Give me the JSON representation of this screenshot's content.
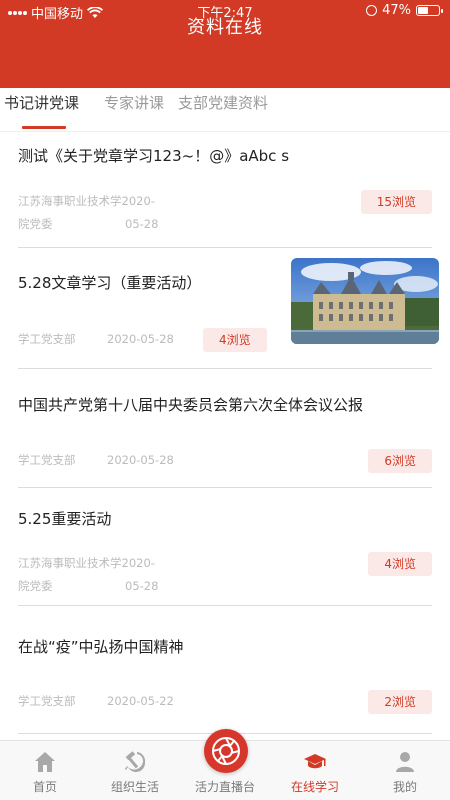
{
  "status_bar": {
    "carrier": "中国移动",
    "time": "下午2:47",
    "battery": "47%"
  },
  "header": {
    "title": "资料在线"
  },
  "tabs": [
    {
      "label": "书记讲党课",
      "active": true
    },
    {
      "label": "专家讲课",
      "active": false
    },
    {
      "label": "支部党建资料",
      "active": false
    }
  ],
  "articles": [
    {
      "title": "测试《关于党章学习123~！@》aAbc s",
      "source_line1": "江苏海事职业技术学2020-",
      "source_line2": "院党委",
      "date_line2": "05-28",
      "views": "15浏览"
    },
    {
      "title": "5.28文章学习（重要活动）",
      "source": "学工党支部",
      "date": "2020-05-28",
      "views": "4浏览",
      "has_image": true
    },
    {
      "title": "中国共产党第十八届中央委员会第六次全体会议公报",
      "source": "学工党支部",
      "date": "2020-05-28",
      "views": "6浏览"
    },
    {
      "title": "5.25重要活动",
      "source_line1": "江苏海事职业技术学2020-",
      "source_line2": "院党委",
      "date_line2": "05-28",
      "views": "4浏览"
    },
    {
      "title": "在战“疫”中弘扬中国精神",
      "source": "学工党支部",
      "date": "2020-05-22",
      "views": "2浏览"
    }
  ],
  "bottom_nav": [
    {
      "label": "首页",
      "icon": "home-icon"
    },
    {
      "label": "组织生活",
      "icon": "party-emblem-icon"
    },
    {
      "label": "活力直播台",
      "icon": "camera-aperture-icon"
    },
    {
      "label": "在线学习",
      "icon": "graduation-cap-icon",
      "active": true
    },
    {
      "label": "我的",
      "icon": "user-icon"
    }
  ],
  "colors": {
    "brand_red": "#d23a26",
    "badge_bg": "#fbe9e7",
    "meta_gray": "#bbbbbb"
  }
}
